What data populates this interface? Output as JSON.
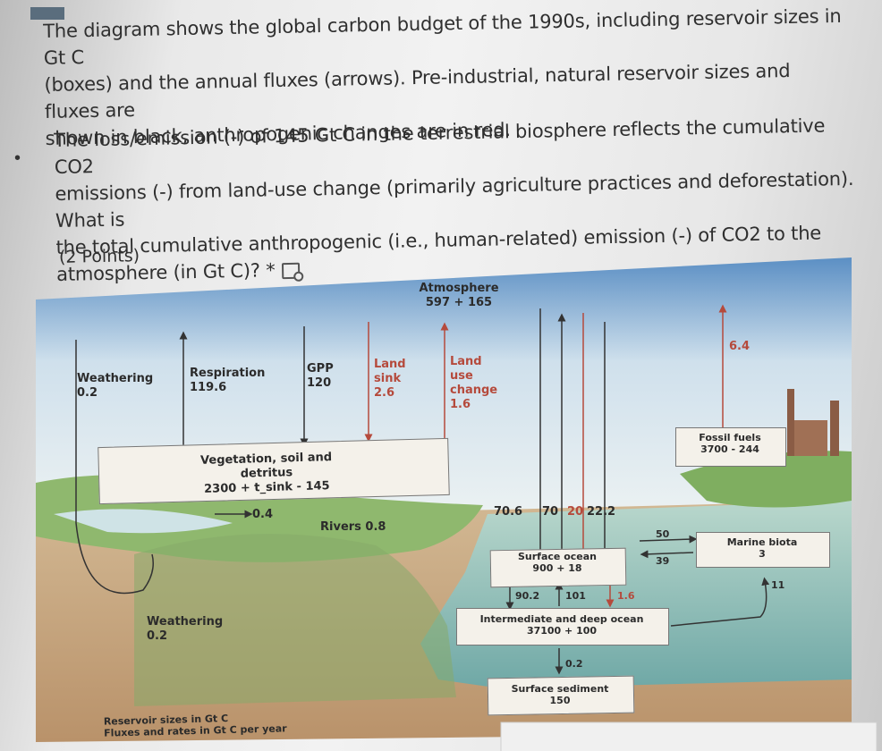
{
  "question": {
    "intro": "The diagram shows the global carbon budget of the 1990s, including reservoir sizes in Gt C\n(boxes) and the annual fluxes (arrows). Pre-industrial, natural reservoir sizes and fluxes are\nshown in black, anthropogenic changes are in red.",
    "prompt": "The loss/emission (-) of 145 Gt C in the terrestrial biosphere reflects the cumulative CO2\nemissions (-) from land-use change (primarily agriculture practices and deforestation). What is\nthe total cumulative anthropogenic (i.e., human-related) emission (-) of CO2 to the\natmosphere (in Gt C)? *",
    "points": "(2 Points)",
    "icon": "image-reader-icon"
  },
  "diagram": {
    "atmosphere": "Atmosphere\n597 + 165",
    "weathering_top": "Weathering\n0.2",
    "respiration": "Respiration\n119.6",
    "gpp": "GPP\n120",
    "land_sink": "Land\nsink\n2.6",
    "land_use_change": "Land\nuse\nchange\n1.6",
    "fossil_flux": "6.4",
    "fossil_fuels": "Fossil fuels\n3700 - 244",
    "vegetation": "Vegetation, soil and detritus\n2300 + t_sink - 145",
    "river_flux": "0.4",
    "rivers": "Rivers 0.8",
    "ocean_exchange_1": "70.6",
    "ocean_exchange_2": "70",
    "ocean_exchange_3": "20",
    "ocean_exchange_4": "22.2",
    "bio_flux_1": "50",
    "bio_flux_2": "39",
    "marine_biota": "Marine biota\n3",
    "bio_flux_3": "11",
    "surface_ocean": "Surface ocean\n900 + 18",
    "deep_flux_1": "90.2",
    "deep_flux_2": "101",
    "deep_flux_3": "1.6",
    "deep_ocean": "Intermediate and deep ocean\n37100 + 100",
    "sediment_flux": "0.2",
    "weathering_bottom": "Weathering\n0.2",
    "sediment": "Surface sediment\n150",
    "legend": "Reservoir sizes in Gt C\nFluxes and rates in Gt C per year"
  },
  "colors": {
    "sky": "#7fa7cc",
    "ocean": "#9fc4bd",
    "land": "#8fb86e",
    "ground": "#c6a882",
    "anthropogenic": "#b54a3c"
  }
}
